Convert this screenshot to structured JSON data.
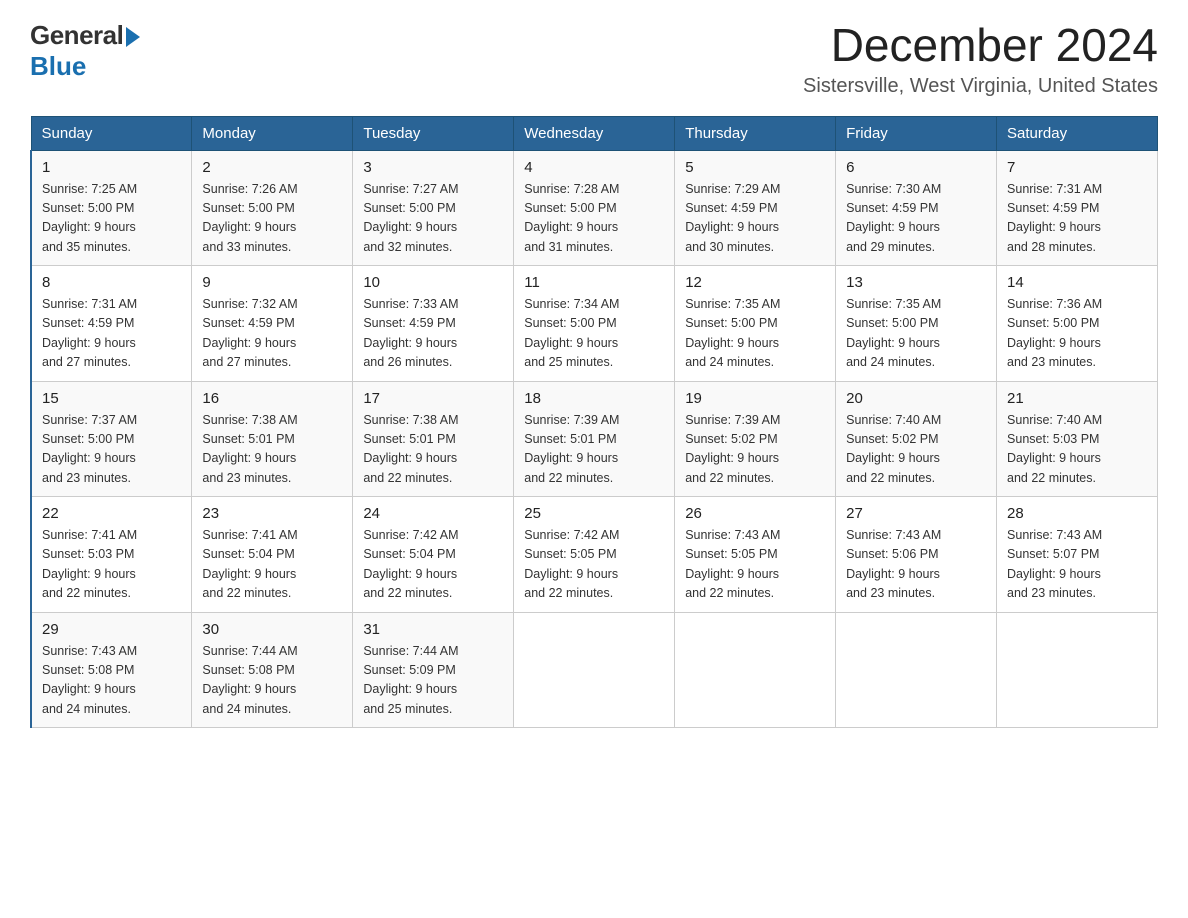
{
  "logo": {
    "general_text": "General",
    "blue_text": "Blue"
  },
  "title": {
    "month_year": "December 2024",
    "location": "Sistersville, West Virginia, United States"
  },
  "days_of_week": [
    "Sunday",
    "Monday",
    "Tuesday",
    "Wednesday",
    "Thursday",
    "Friday",
    "Saturday"
  ],
  "weeks": [
    [
      {
        "day": "1",
        "sunrise": "7:25 AM",
        "sunset": "5:00 PM",
        "daylight": "9 hours and 35 minutes."
      },
      {
        "day": "2",
        "sunrise": "7:26 AM",
        "sunset": "5:00 PM",
        "daylight": "9 hours and 33 minutes."
      },
      {
        "day": "3",
        "sunrise": "7:27 AM",
        "sunset": "5:00 PM",
        "daylight": "9 hours and 32 minutes."
      },
      {
        "day": "4",
        "sunrise": "7:28 AM",
        "sunset": "5:00 PM",
        "daylight": "9 hours and 31 minutes."
      },
      {
        "day": "5",
        "sunrise": "7:29 AM",
        "sunset": "4:59 PM",
        "daylight": "9 hours and 30 minutes."
      },
      {
        "day": "6",
        "sunrise": "7:30 AM",
        "sunset": "4:59 PM",
        "daylight": "9 hours and 29 minutes."
      },
      {
        "day": "7",
        "sunrise": "7:31 AM",
        "sunset": "4:59 PM",
        "daylight": "9 hours and 28 minutes."
      }
    ],
    [
      {
        "day": "8",
        "sunrise": "7:31 AM",
        "sunset": "4:59 PM",
        "daylight": "9 hours and 27 minutes."
      },
      {
        "day": "9",
        "sunrise": "7:32 AM",
        "sunset": "4:59 PM",
        "daylight": "9 hours and 27 minutes."
      },
      {
        "day": "10",
        "sunrise": "7:33 AM",
        "sunset": "4:59 PM",
        "daylight": "9 hours and 26 minutes."
      },
      {
        "day": "11",
        "sunrise": "7:34 AM",
        "sunset": "5:00 PM",
        "daylight": "9 hours and 25 minutes."
      },
      {
        "day": "12",
        "sunrise": "7:35 AM",
        "sunset": "5:00 PM",
        "daylight": "9 hours and 24 minutes."
      },
      {
        "day": "13",
        "sunrise": "7:35 AM",
        "sunset": "5:00 PM",
        "daylight": "9 hours and 24 minutes."
      },
      {
        "day": "14",
        "sunrise": "7:36 AM",
        "sunset": "5:00 PM",
        "daylight": "9 hours and 23 minutes."
      }
    ],
    [
      {
        "day": "15",
        "sunrise": "7:37 AM",
        "sunset": "5:00 PM",
        "daylight": "9 hours and 23 minutes."
      },
      {
        "day": "16",
        "sunrise": "7:38 AM",
        "sunset": "5:01 PM",
        "daylight": "9 hours and 23 minutes."
      },
      {
        "day": "17",
        "sunrise": "7:38 AM",
        "sunset": "5:01 PM",
        "daylight": "9 hours and 22 minutes."
      },
      {
        "day": "18",
        "sunrise": "7:39 AM",
        "sunset": "5:01 PM",
        "daylight": "9 hours and 22 minutes."
      },
      {
        "day": "19",
        "sunrise": "7:39 AM",
        "sunset": "5:02 PM",
        "daylight": "9 hours and 22 minutes."
      },
      {
        "day": "20",
        "sunrise": "7:40 AM",
        "sunset": "5:02 PM",
        "daylight": "9 hours and 22 minutes."
      },
      {
        "day": "21",
        "sunrise": "7:40 AM",
        "sunset": "5:03 PM",
        "daylight": "9 hours and 22 minutes."
      }
    ],
    [
      {
        "day": "22",
        "sunrise": "7:41 AM",
        "sunset": "5:03 PM",
        "daylight": "9 hours and 22 minutes."
      },
      {
        "day": "23",
        "sunrise": "7:41 AM",
        "sunset": "5:04 PM",
        "daylight": "9 hours and 22 minutes."
      },
      {
        "day": "24",
        "sunrise": "7:42 AM",
        "sunset": "5:04 PM",
        "daylight": "9 hours and 22 minutes."
      },
      {
        "day": "25",
        "sunrise": "7:42 AM",
        "sunset": "5:05 PM",
        "daylight": "9 hours and 22 minutes."
      },
      {
        "day": "26",
        "sunrise": "7:43 AM",
        "sunset": "5:05 PM",
        "daylight": "9 hours and 22 minutes."
      },
      {
        "day": "27",
        "sunrise": "7:43 AM",
        "sunset": "5:06 PM",
        "daylight": "9 hours and 23 minutes."
      },
      {
        "day": "28",
        "sunrise": "7:43 AM",
        "sunset": "5:07 PM",
        "daylight": "9 hours and 23 minutes."
      }
    ],
    [
      {
        "day": "29",
        "sunrise": "7:43 AM",
        "sunset": "5:08 PM",
        "daylight": "9 hours and 24 minutes."
      },
      {
        "day": "30",
        "sunrise": "7:44 AM",
        "sunset": "5:08 PM",
        "daylight": "9 hours and 24 minutes."
      },
      {
        "day": "31",
        "sunrise": "7:44 AM",
        "sunset": "5:09 PM",
        "daylight": "9 hours and 25 minutes."
      },
      null,
      null,
      null,
      null
    ]
  ],
  "labels": {
    "sunrise_prefix": "Sunrise: ",
    "sunset_prefix": "Sunset: ",
    "daylight_prefix": "Daylight: "
  }
}
